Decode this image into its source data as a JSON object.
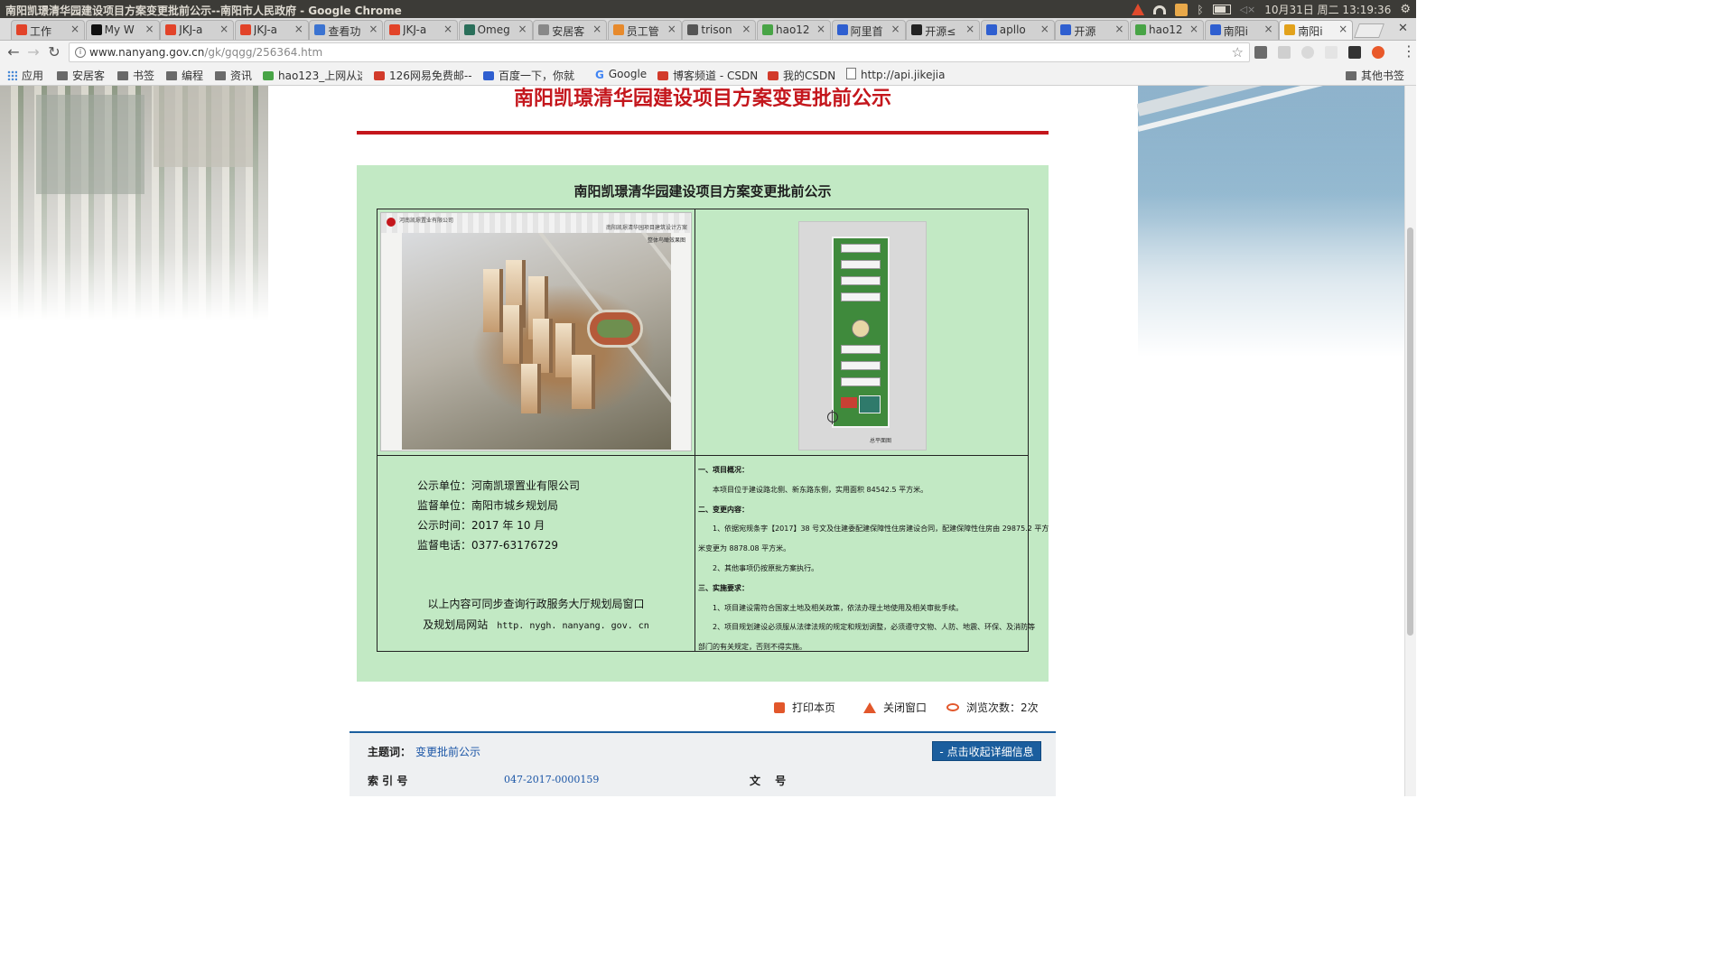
{
  "os": {
    "window_title": "南阳凯璟清华园建设项目方案变更批前公示--南阳市人民政府 - Google Chrome",
    "clock": "10月31日 周二 13:19:36"
  },
  "tabs": [
    {
      "label": "工作",
      "color": "#e24329"
    },
    {
      "label": "My W",
      "color": "#111111"
    },
    {
      "label": "JKJ-a",
      "color": "#e24329"
    },
    {
      "label": "JKJ-a",
      "color": "#e24329"
    },
    {
      "label": "查看功",
      "color": "#3b73d1"
    },
    {
      "label": "JKJ-a",
      "color": "#e24329"
    },
    {
      "label": "Omeg",
      "color": "#2a6f5a"
    },
    {
      "label": "安居客",
      "color": "#888888"
    },
    {
      "label": "员工管",
      "color": "#e78a2c"
    },
    {
      "label": "trison",
      "color": "#555555"
    },
    {
      "label": "hao12",
      "color": "#48a446"
    },
    {
      "label": "阿里首",
      "color": "#2f5fd0"
    },
    {
      "label": "开源≤",
      "color": "#222222"
    },
    {
      "label": "apllo",
      "color": "#2f5fd0"
    },
    {
      "label": "开源",
      "color": "#2f5fd0"
    },
    {
      "label": "hao12",
      "color": "#48a446"
    },
    {
      "label": "南阳i",
      "color": "#2f5fd0"
    },
    {
      "label": "南阳i",
      "color": "#e2a21c"
    }
  ],
  "toolbar": {
    "url_host": "www.nanyang.gov.cn",
    "url_path": "/gk/gqgg/256364.htm"
  },
  "bookmarks": [
    {
      "label": "应用",
      "icon": "apps-icon"
    },
    {
      "label": "安居客",
      "icon": "folder-icon"
    },
    {
      "label": "书签",
      "icon": "folder-icon"
    },
    {
      "label": "编程",
      "icon": "folder-icon"
    },
    {
      "label": "资讯",
      "icon": "folder-icon"
    },
    {
      "label": "hao123_上网从这",
      "icon": "hao123-icon"
    },
    {
      "label": "126网易免费邮--",
      "icon": "netease-icon"
    },
    {
      "label": "百度一下，你就",
      "icon": "baidu-icon"
    },
    {
      "label": "Google",
      "icon": "google-icon"
    },
    {
      "label": "博客频道 - CSDN",
      "icon": "csdn-icon"
    },
    {
      "label": "我的CSDN",
      "icon": "csdn-icon"
    },
    {
      "label": "http://api.jikejia",
      "icon": "page-icon"
    },
    {
      "label": "其他书签",
      "icon": "folder-icon"
    }
  ],
  "article": {
    "title": "南阳凯璟清华园建设项目方案变更批前公示"
  },
  "notice": {
    "title": "南阳凯璟清华园建设项目方案变更批前公示",
    "render_company": "河南凯璟置业有限公司",
    "render_caption": "南阳凯璟清华园项目建筑设计方案",
    "render_sub": "整体鸟瞰效果图",
    "plan_label": "总平面图",
    "info": {
      "publisher_label": "公示单位：",
      "publisher": "河南凯璟置业有限公司",
      "supervisor_label": "监督单位：",
      "supervisor": "南阳市城乡规划局",
      "time_label": "公示时间：",
      "time": "2017 年 10 月",
      "phone_label": "监督电话：",
      "phone": "0377-63176729",
      "note1": "以上内容可同步查询行政服务大厅规划局窗口",
      "note2": "及规划局网站",
      "site": "http. nygh. nanyang. gov. cn"
    },
    "desc": {
      "h1": "一、项目概况：",
      "p1": "本项目位于建设路北侧、新东路东侧，实用面积 84542.5 平方米。",
      "h2": "二、变更内容：",
      "p2a": "1、依据宛规条字【2017】38 号文及住建委配建保障性住房建设合同，配建保障性住房由 29875.2 平方",
      "p2b": "米变更为 8878.08 平方米。",
      "p3": "2、其他事项仍按原批方案执行。",
      "h3": "三、实施要求：",
      "p4": "1、项目建设需符合国家土地及相关政策，依法办理土地使用及相关审批手续。",
      "p5a": "2、项目规划建设必须服从法律法规的规定和规划调整，必须遵守文物、人防、地震、环保、及消防等",
      "p5b": "部门的有关规定，否则不得实施。"
    }
  },
  "actions": {
    "print": "打印本页",
    "close": "关闭窗口",
    "views": "浏览次数：2次"
  },
  "meta": {
    "topic_label": "主题词：",
    "topic": "变更批前公示",
    "toggle_button": "- 点击收起详细信息",
    "index_label": "索 引 号",
    "index_value": "047-2017-0000159",
    "doc_label": "文　 号"
  }
}
